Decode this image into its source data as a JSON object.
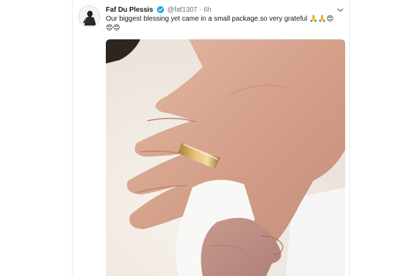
{
  "tweet": {
    "author_name": "Faf Du Plessis",
    "handle": "@faf1307",
    "separator": "·",
    "time": "6h",
    "text": "Our biggest blessing yet came in a small package.so very grateful",
    "emojis_inline": "🙏🙏😍",
    "emojis_second_line": "😍😍"
  },
  "icons": {
    "verified": "verified-badge-icon",
    "menu": "chevron-down-icon",
    "avatar": "profile-avatar"
  },
  "colors": {
    "verified_blue": "#1da1f2",
    "name_text": "#14171a",
    "secondary_text": "#657786"
  }
}
